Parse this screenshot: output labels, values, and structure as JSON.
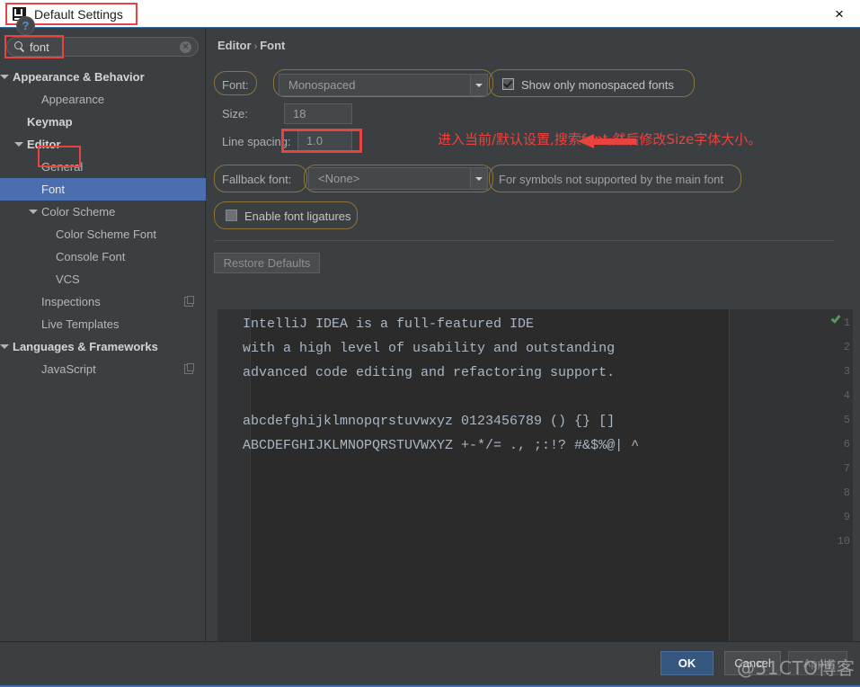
{
  "window": {
    "title": "Default Settings",
    "logo_icon": "intellij-idea-logo",
    "close_icon": "×"
  },
  "sidebar": {
    "search": {
      "value": "font",
      "icon": "search-icon",
      "clear_icon": "✕"
    },
    "items": [
      {
        "label": "Appearance & Behavior",
        "indent": 14,
        "arrow": true,
        "bold": true,
        "selected": false,
        "badge": false
      },
      {
        "label": "Appearance",
        "indent": 46,
        "arrow": false,
        "bold": false,
        "selected": false,
        "badge": false
      },
      {
        "label": "Keymap",
        "indent": 30,
        "arrow": false,
        "bold": true,
        "selected": false,
        "badge": false
      },
      {
        "label": "Editor",
        "indent": 30,
        "arrow": true,
        "bold": true,
        "selected": false,
        "badge": false
      },
      {
        "label": "General",
        "indent": 46,
        "arrow": false,
        "bold": false,
        "selected": false,
        "badge": false
      },
      {
        "label": "Font",
        "indent": 46,
        "arrow": false,
        "bold": false,
        "selected": true,
        "badge": false
      },
      {
        "label": "Color Scheme",
        "indent": 46,
        "arrow": true,
        "bold": false,
        "selected": false,
        "badge": false
      },
      {
        "label": "Color Scheme Font",
        "indent": 62,
        "arrow": false,
        "bold": false,
        "selected": false,
        "badge": false
      },
      {
        "label": "Console Font",
        "indent": 62,
        "arrow": false,
        "bold": false,
        "selected": false,
        "badge": false
      },
      {
        "label": "VCS",
        "indent": 62,
        "arrow": false,
        "bold": false,
        "selected": false,
        "badge": false
      },
      {
        "label": "Inspections",
        "indent": 46,
        "arrow": false,
        "bold": false,
        "selected": false,
        "badge": true
      },
      {
        "label": "Live Templates",
        "indent": 46,
        "arrow": false,
        "bold": false,
        "selected": false,
        "badge": false
      },
      {
        "label": "Languages & Frameworks",
        "indent": 14,
        "arrow": true,
        "bold": true,
        "selected": false,
        "badge": false
      },
      {
        "label": "JavaScript",
        "indent": 46,
        "arrow": false,
        "bold": false,
        "selected": false,
        "badge": true
      }
    ]
  },
  "breadcrumb": {
    "root": "Editor",
    "separator": "›",
    "leaf": "Font"
  },
  "settings": {
    "font_label": "Font:",
    "font_value": "Monospaced",
    "show_only_monospaced_label": "Show only monospaced fonts",
    "show_only_monospaced_checked": true,
    "size_label": "Size:",
    "size_value": "18",
    "line_spacing_label": "Line spacing:",
    "line_spacing_value": "1.0",
    "fallback_font_label": "Fallback font:",
    "fallback_font_value": "<None>",
    "fallback_hint": "For symbols not supported by the main font",
    "enable_ligatures_label": "Enable font ligatures",
    "enable_ligatures_checked": false,
    "restore_defaults_label": "Restore Defaults"
  },
  "preview": {
    "line_numbers": [
      "1",
      "2",
      "3",
      "4",
      "5",
      "6",
      "7",
      "8",
      "9",
      "10"
    ],
    "lines": [
      "IntelliJ IDEA is a full-featured IDE",
      "with a high level of usability and outstanding",
      "advanced code editing and refactoring support.",
      "",
      "abcdefghijklmnopqrstuvwxyz 0123456789 () {} []",
      "ABCDEFGHIJKLMNOPQRSTUVWXYZ +-*/= ., ;:!? #&$%@| ^",
      "",
      "",
      "",
      ""
    ],
    "inspection_icon": "green-check-icon"
  },
  "annotation": {
    "text": "进入当前/默认设置,搜索font,然后修改Size字体大小。",
    "color": "#e8433f",
    "arrow_icon": "left-arrow-icon"
  },
  "footer": {
    "help_label": "?",
    "ok_label": "OK",
    "cancel_label": "Cancel",
    "apply_label": "Apply",
    "watermark": "@51CTO博客"
  },
  "colors": {
    "window_bg": "#3c3f41",
    "editor_bg": "#2b2b2b",
    "selection_blue": "#4b6eaf",
    "accent_red": "#e8433f",
    "ok_blue": "#365880",
    "highlight_ring": "#8a7438"
  }
}
